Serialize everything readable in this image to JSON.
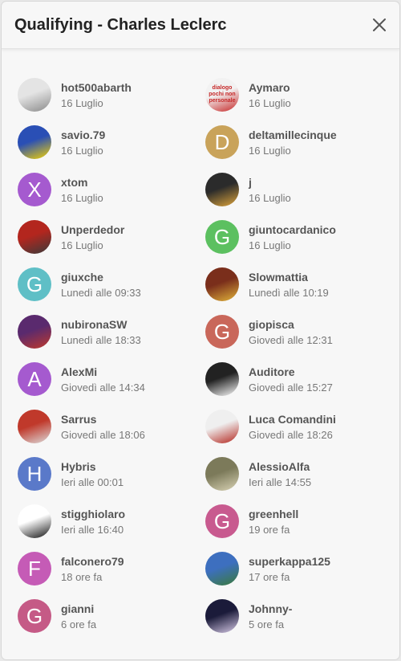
{
  "dialog": {
    "title": "Qualifying - Charles Leclerc"
  },
  "users": [
    {
      "name": "hot500abarth",
      "when": "16 Luglio",
      "avatar": {
        "type": "photo",
        "colors": [
          "#e4e4e4",
          "#8a8a8a"
        ]
      }
    },
    {
      "name": "Aymaro",
      "when": "16 Luglio",
      "avatar": {
        "type": "photo",
        "text": "dialogo pochi non personale",
        "colors": [
          "#f2f2f2",
          "#c62828"
        ]
      }
    },
    {
      "name": "savio.79",
      "when": "16 Luglio",
      "avatar": {
        "type": "photo",
        "colors": [
          "#2a4fb5",
          "#f4d400"
        ]
      }
    },
    {
      "name": "deltamillecinque",
      "when": "16 Luglio",
      "avatar": {
        "type": "letter",
        "letter": "D",
        "colors": [
          "#c9a35a"
        ]
      }
    },
    {
      "name": "xtom",
      "when": "16 Luglio",
      "avatar": {
        "type": "letter",
        "letter": "X",
        "colors": [
          "#a55acf"
        ]
      }
    },
    {
      "name": "j",
      "when": "16 Luglio",
      "avatar": {
        "type": "photo",
        "colors": [
          "#2b2b2b",
          "#e0a63c"
        ]
      }
    },
    {
      "name": "Unperdedor",
      "when": "16 Luglio",
      "avatar": {
        "type": "photo",
        "colors": [
          "#b3261e",
          "#3a3a3a"
        ]
      }
    },
    {
      "name": "giuntocardanico",
      "when": "16 Luglio",
      "avatar": {
        "type": "letter",
        "letter": "G",
        "colors": [
          "#5cc060"
        ]
      }
    },
    {
      "name": "giuxche",
      "when": "Lunedì alle 09:33",
      "avatar": {
        "type": "letter",
        "letter": "G",
        "colors": [
          "#5fbfc6"
        ]
      }
    },
    {
      "name": "Slowmattia",
      "when": "Lunedì alle 10:19",
      "avatar": {
        "type": "photo",
        "colors": [
          "#7a2e1b",
          "#e2b43a"
        ]
      }
    },
    {
      "name": "nubironaSW",
      "when": "Lunedì alle 18:33",
      "avatar": {
        "type": "photo",
        "colors": [
          "#5a2a6e",
          "#c0392b"
        ]
      }
    },
    {
      "name": "giopisca",
      "when": "Giovedì alle 12:31",
      "avatar": {
        "type": "letter",
        "letter": "G",
        "colors": [
          "#c9675a"
        ]
      }
    },
    {
      "name": "AlexMi",
      "when": "Giovedì alle 14:34",
      "avatar": {
        "type": "letter",
        "letter": "A",
        "colors": [
          "#a55acf"
        ]
      }
    },
    {
      "name": "Auditore",
      "when": "Giovedì alle 15:27",
      "avatar": {
        "type": "photo",
        "colors": [
          "#222222",
          "#ffffff"
        ]
      }
    },
    {
      "name": "Sarrus",
      "when": "Giovedì alle 18:06",
      "avatar": {
        "type": "photo",
        "colors": [
          "#c0392b",
          "#dcdcdc"
        ]
      }
    },
    {
      "name": "Luca Comandini",
      "when": "Giovedì alle 18:26",
      "avatar": {
        "type": "photo",
        "colors": [
          "#efefef",
          "#b3261e"
        ]
      }
    },
    {
      "name": "Hybris",
      "when": "Ieri alle 00:01",
      "avatar": {
        "type": "letter",
        "letter": "H",
        "colors": [
          "#5a79c9"
        ]
      }
    },
    {
      "name": "AlessioAlfa",
      "when": "Ieri alle 14:55",
      "avatar": {
        "type": "photo",
        "colors": [
          "#7c7a5a",
          "#d9d3b5"
        ]
      }
    },
    {
      "name": "stigghiolaro",
      "when": "Ieri alle 16:40",
      "avatar": {
        "type": "photo",
        "colors": [
          "#ffffff",
          "#111111"
        ]
      }
    },
    {
      "name": "greenhell",
      "when": "19 ore fa",
      "avatar": {
        "type": "letter",
        "letter": "G",
        "colors": [
          "#c85a8f"
        ]
      }
    },
    {
      "name": "falconero79",
      "when": "18 ore fa",
      "avatar": {
        "type": "letter",
        "letter": "F",
        "colors": [
          "#c55bb6"
        ]
      }
    },
    {
      "name": "superkappa125",
      "when": "17 ore fa",
      "avatar": {
        "type": "photo",
        "colors": [
          "#3d6fbf",
          "#3a7a3a"
        ]
      }
    },
    {
      "name": "gianni",
      "when": "6 ore fa",
      "avatar": {
        "type": "letter",
        "letter": "G",
        "colors": [
          "#c55a86"
        ]
      }
    },
    {
      "name": "Johnny-",
      "when": "5 ore fa",
      "avatar": {
        "type": "photo",
        "colors": [
          "#1b1b3a",
          "#d8cbe8"
        ]
      }
    }
  ]
}
